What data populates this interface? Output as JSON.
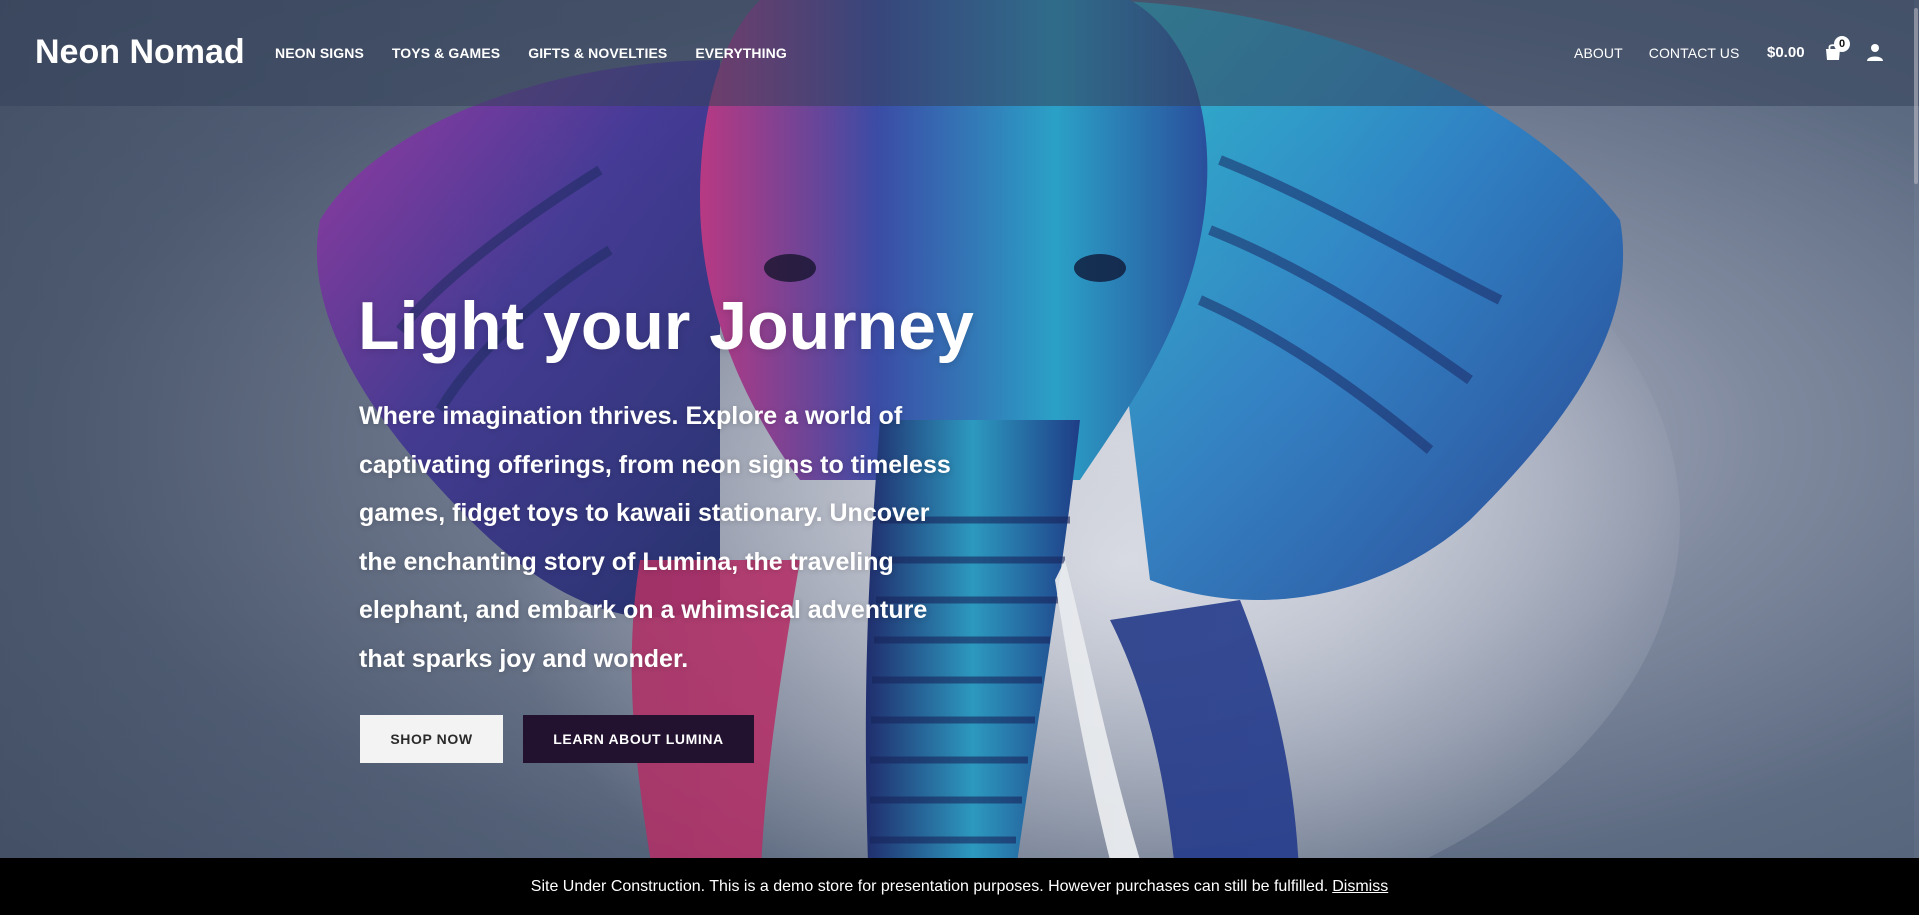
{
  "header": {
    "logo": "Neon Nomad",
    "main_nav": [
      {
        "label": "NEON SIGNS"
      },
      {
        "label": "TOYS & GAMES"
      },
      {
        "label": "GIFTS & NOVELTIES"
      },
      {
        "label": "EVERYTHING"
      }
    ],
    "secondary_nav": [
      {
        "label": "ABOUT"
      },
      {
        "label": "CONTACT US"
      }
    ],
    "cart_total": "$0.00",
    "cart_count": "0",
    "icons": [
      "shopping-bag-icon",
      "user-icon"
    ]
  },
  "hero": {
    "title": "Light your Journey",
    "text": "Where imagination thrives. Explore a world of captivating offerings, from neon signs to timeless games, fidget toys to kawaii stationary. Uncover the enchanting story of Lumina, the traveling elephant, and embark on a whimsical adventure that sparks joy and wonder.",
    "primary_button": "SHOP NOW",
    "secondary_button": "LEARN ABOUT LUMINA"
  },
  "notice": {
    "text": "Site Under Construction. This is a demo store for presentation purposes. However purchases can still be fulfilled.",
    "dismiss_label": "Dismiss"
  },
  "colors": {
    "header_bg": "#34425a",
    "accent_button": "#231130",
    "notice_bg": "#000000",
    "text": "#ffffff"
  }
}
